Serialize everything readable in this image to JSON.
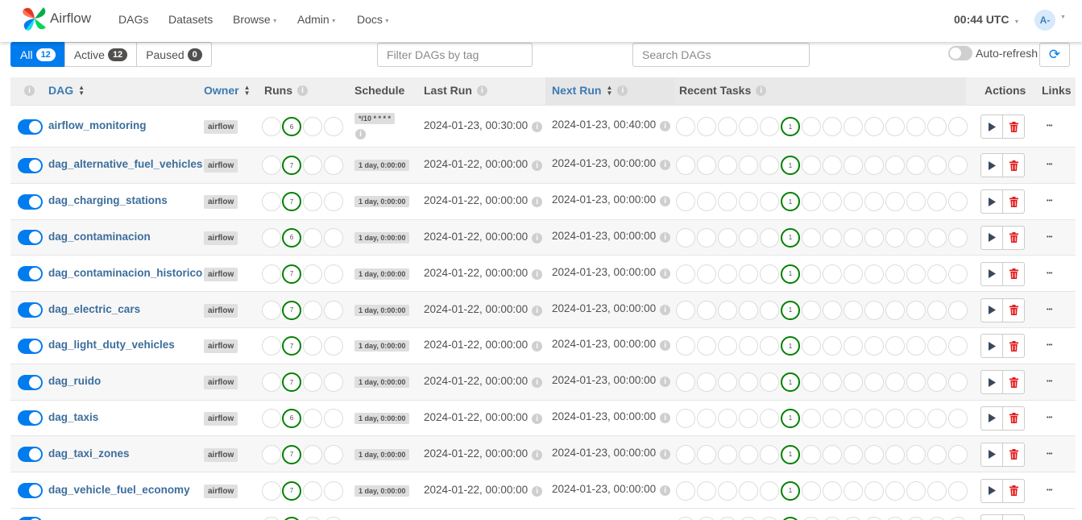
{
  "navbar": {
    "brand": "Airflow",
    "menu": [
      {
        "label": "DAGs",
        "dropdown": false
      },
      {
        "label": "Datasets",
        "dropdown": false
      },
      {
        "label": "Browse",
        "dropdown": true
      },
      {
        "label": "Admin",
        "dropdown": true
      },
      {
        "label": "Docs",
        "dropdown": true
      }
    ],
    "clock": "00:44 UTC",
    "user_initials": "A-"
  },
  "filters": {
    "tabs": [
      {
        "label": "All",
        "count": "12",
        "active": true
      },
      {
        "label": "Active",
        "count": "12",
        "active": false
      },
      {
        "label": "Paused",
        "count": "0",
        "active": false
      }
    ],
    "tag_placeholder": "Filter DAGs by tag",
    "search_placeholder": "Search DAGs",
    "auto_refresh_label": "Auto-refresh",
    "auto_refresh_on": false
  },
  "table": {
    "headers": {
      "dag": "DAG",
      "owner": "Owner",
      "runs": "Runs",
      "schedule": "Schedule",
      "last_run": "Last Run",
      "next_run": "Next Run",
      "recent_tasks": "Recent Tasks",
      "actions": "Actions",
      "links": "Links"
    },
    "rows": [
      {
        "dag_id": "airflow_monitoring",
        "owner": "airflow",
        "runs_success": "6",
        "schedule": "*/10 * * * *",
        "last_run": "2024-01-23, 00:30:00",
        "next_run": "2024-01-23, 00:40:00",
        "tasks_success": "1",
        "active": true
      },
      {
        "dag_id": "dag_alternative_fuel_vehicles",
        "owner": "airflow",
        "runs_success": "7",
        "schedule": "1 day, 0:00:00",
        "last_run": "2024-01-22, 00:00:00",
        "next_run": "2024-01-23, 00:00:00",
        "tasks_success": "1",
        "active": true
      },
      {
        "dag_id": "dag_charging_stations",
        "owner": "airflow",
        "runs_success": "7",
        "schedule": "1 day, 0:00:00",
        "last_run": "2024-01-22, 00:00:00",
        "next_run": "2024-01-23, 00:00:00",
        "tasks_success": "1",
        "active": true
      },
      {
        "dag_id": "dag_contaminacion",
        "owner": "airflow",
        "runs_success": "6",
        "schedule": "1 day, 0:00:00",
        "last_run": "2024-01-22, 00:00:00",
        "next_run": "2024-01-23, 00:00:00",
        "tasks_success": "1",
        "active": true
      },
      {
        "dag_id": "dag_contaminacion_historico",
        "owner": "airflow",
        "runs_success": "7",
        "schedule": "1 day, 0:00:00",
        "last_run": "2024-01-22, 00:00:00",
        "next_run": "2024-01-23, 00:00:00",
        "tasks_success": "1",
        "active": true
      },
      {
        "dag_id": "dag_electric_cars",
        "owner": "airflow",
        "runs_success": "7",
        "schedule": "1 day, 0:00:00",
        "last_run": "2024-01-22, 00:00:00",
        "next_run": "2024-01-23, 00:00:00",
        "tasks_success": "1",
        "active": true
      },
      {
        "dag_id": "dag_light_duty_vehicles",
        "owner": "airflow",
        "runs_success": "7",
        "schedule": "1 day, 0:00:00",
        "last_run": "2024-01-22, 00:00:00",
        "next_run": "2024-01-23, 00:00:00",
        "tasks_success": "1",
        "active": true
      },
      {
        "dag_id": "dag_ruido",
        "owner": "airflow",
        "runs_success": "7",
        "schedule": "1 day, 0:00:00",
        "last_run": "2024-01-22, 00:00:00",
        "next_run": "2024-01-23, 00:00:00",
        "tasks_success": "1",
        "active": true
      },
      {
        "dag_id": "dag_taxis",
        "owner": "airflow",
        "runs_success": "6",
        "schedule": "1 day, 0:00:00",
        "last_run": "2024-01-22, 00:00:00",
        "next_run": "2024-01-23, 00:00:00",
        "tasks_success": "1",
        "active": true
      },
      {
        "dag_id": "dag_taxi_zones",
        "owner": "airflow",
        "runs_success": "7",
        "schedule": "1 day, 0:00:00",
        "last_run": "2024-01-22, 00:00:00",
        "next_run": "2024-01-23, 00:00:00",
        "tasks_success": "1",
        "active": true
      },
      {
        "dag_id": "dag_vehicle_fuel_economy",
        "owner": "airflow",
        "runs_success": "7",
        "schedule": "1 day, 0:00:00",
        "last_run": "2024-01-22, 00:00:00",
        "next_run": "2024-01-23, 00:00:00",
        "tasks_success": "1",
        "active": true
      }
    ]
  },
  "colors": {
    "accent": "#017cee",
    "success": "#008000",
    "delete": "#e31c1c",
    "dag_link": "#3c6e9c"
  },
  "icons": {
    "play": "play-icon",
    "delete": "trash-icon",
    "more": "more-icon",
    "refresh": "refresh-icon",
    "info": "info-icon",
    "sort": "sort-icon"
  }
}
